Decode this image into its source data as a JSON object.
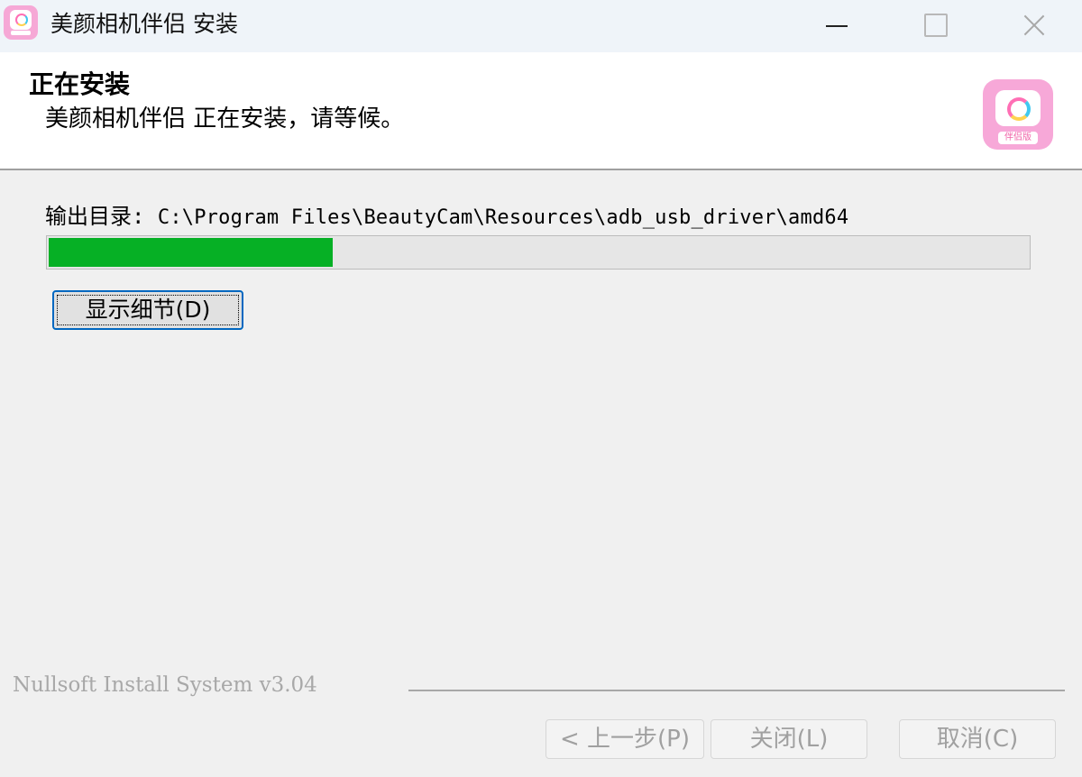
{
  "window": {
    "title": "美颜相机伴侣 安装",
    "icon": "app-logo-icon"
  },
  "header": {
    "title": "正在安装",
    "subtitle": "美颜相机伴侣 正在安装，请等候。",
    "logo_badge": "伴侣版"
  },
  "main": {
    "output_label": "输出目录:",
    "output_path": "C:\\Program Files\\BeautyCam\\Resources\\adb_usb_driver\\amd64",
    "progress_fraction": 0.29,
    "progress_color": "#06b025",
    "details_button": "显示细节(D)"
  },
  "footer": {
    "branding": "Nullsoft Install System v3.04",
    "back_button": "< 上一步(P)",
    "close_button": "关闭(L)",
    "cancel_button": "取消(C)"
  }
}
